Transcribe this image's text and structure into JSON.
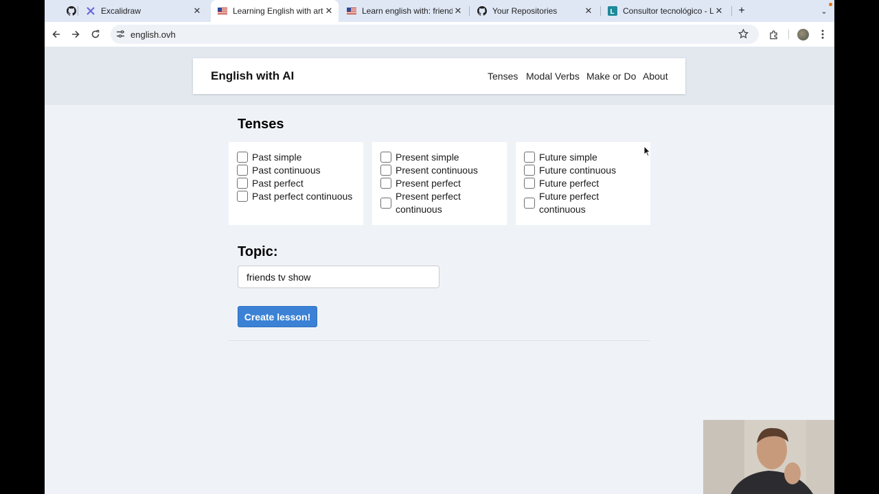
{
  "browser": {
    "tabs": [
      {
        "title": "",
        "icon": "github-icon"
      },
      {
        "title": "Excalidraw",
        "icon": "excalidraw-icon"
      },
      {
        "title": "Learning English with artificia",
        "icon": "us-flag-icon",
        "active": true
      },
      {
        "title": "Learn english with: friends tv",
        "icon": "us-flag-icon"
      },
      {
        "title": "Your Repositories",
        "icon": "github-icon"
      },
      {
        "title": "Consultor tecnológico - Luis",
        "icon": "linkedin-l-icon"
      }
    ],
    "new_tab_label": "+",
    "url": "english.ovh"
  },
  "nav": {
    "brand": "English with AI",
    "links": [
      "Tenses",
      "Modal Verbs",
      "Make or Do",
      "About"
    ]
  },
  "tenses": {
    "heading": "Tenses",
    "groups": [
      {
        "options": [
          {
            "label": "Past simple",
            "checked": false
          },
          {
            "label": "Past continuous",
            "checked": false
          },
          {
            "label": "Past perfect",
            "checked": false
          },
          {
            "label": "Past perfect continuous",
            "checked": false
          }
        ]
      },
      {
        "options": [
          {
            "label": "Present simple",
            "checked": false
          },
          {
            "label": "Present continuous",
            "checked": false
          },
          {
            "label": "Present perfect",
            "checked": false
          },
          {
            "label": "Present perfect continuous",
            "checked": false
          }
        ]
      },
      {
        "options": [
          {
            "label": "Future simple",
            "checked": false
          },
          {
            "label": "Future continuous",
            "checked": false
          },
          {
            "label": "Future perfect",
            "checked": false
          },
          {
            "label": "Future perfect continuous",
            "checked": false
          }
        ]
      }
    ]
  },
  "topic": {
    "heading": "Topic:",
    "value": "friends tv show"
  },
  "create_button": "Create lesson!",
  "colors": {
    "button": "#3b82d6",
    "page_bg": "#eff3f7",
    "tabstrip_bg": "#dfe7f5"
  }
}
